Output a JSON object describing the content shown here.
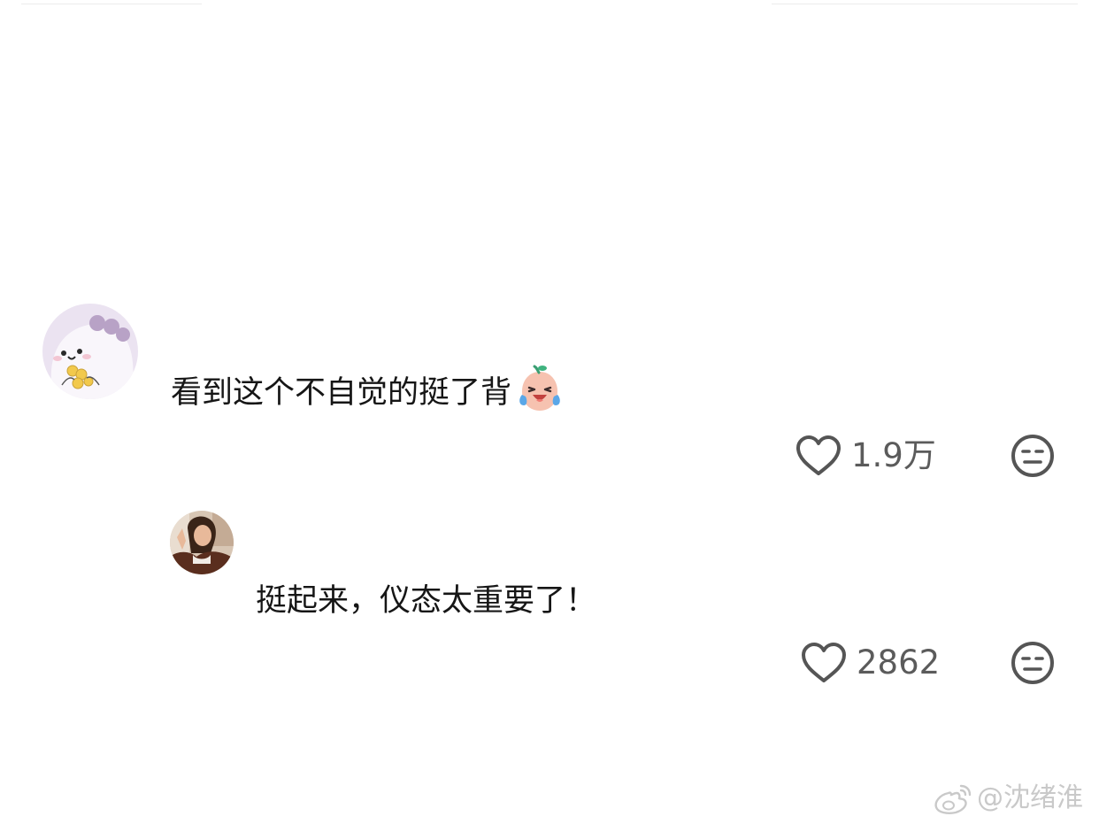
{
  "comments": [
    {
      "avatar": "pink-blob-cartoon-avatar",
      "text": "看到这个不自觉的挺了背",
      "emoji": "laughing-with-tears-emoji",
      "likes": "1.9万"
    },
    {
      "avatar": "woman-photo-avatar",
      "text": "挺起来，仪态太重要了！",
      "likes": "2862"
    }
  ],
  "watermark": {
    "icon": "weibo-logo-icon",
    "text": "@沈绪淮"
  },
  "colors": {
    "text": "#161616",
    "count": "#5b5b5b",
    "icon": "#555555",
    "watermark": "#c9c9c9",
    "avatar_bg": "#e7ddef"
  }
}
